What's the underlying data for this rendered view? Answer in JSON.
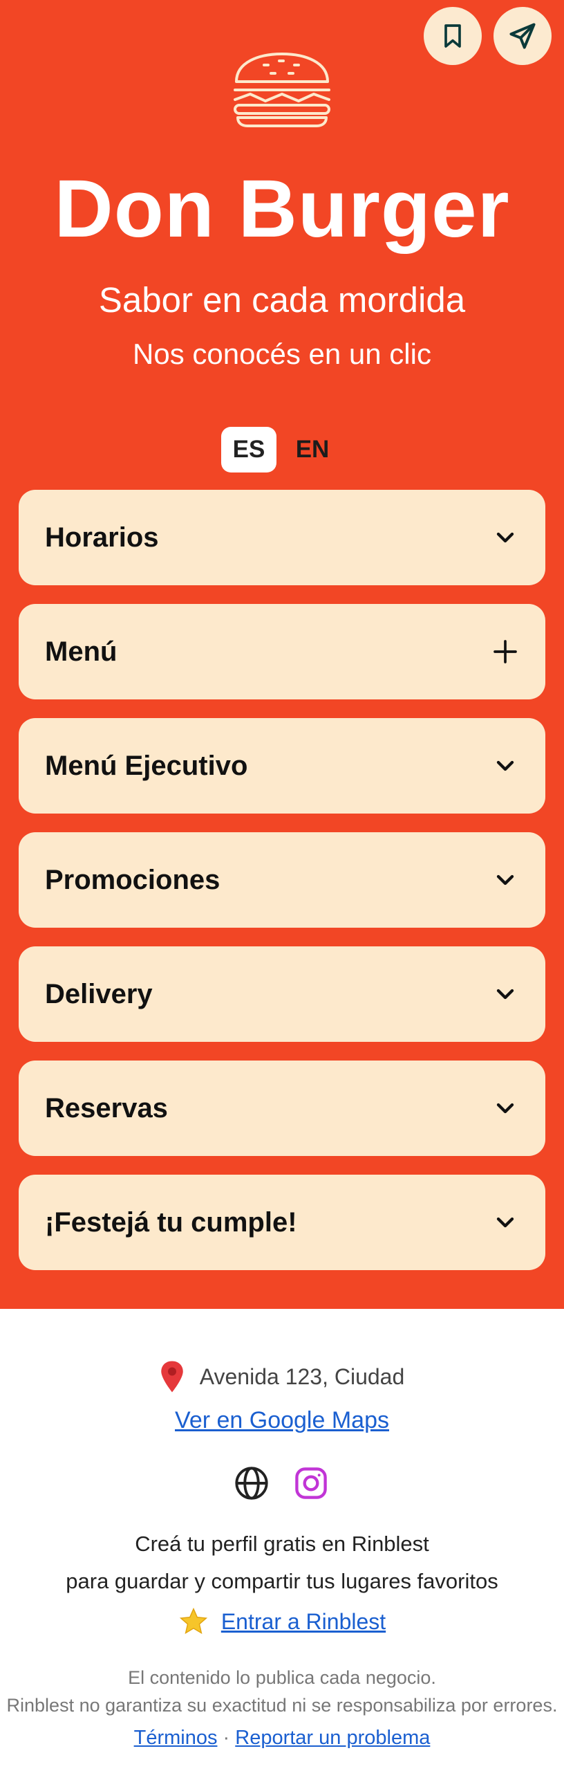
{
  "header": {
    "bookmark_icon": "bookmark-icon",
    "share_icon": "send-icon",
    "logo_icon": "burger-icon",
    "title": "Don Burger",
    "subtitle": "Sabor en cada mordida",
    "tagline": "Nos conocés en un clic"
  },
  "language": {
    "selected": "ES",
    "options": [
      "ES",
      "EN"
    ]
  },
  "sections": [
    {
      "label": "Horarios",
      "icon": "chevron-down-icon"
    },
    {
      "label": "Menú",
      "icon": "plus-icon"
    },
    {
      "label": "Menú Ejecutivo",
      "icon": "chevron-down-icon"
    },
    {
      "label": "Promociones",
      "icon": "chevron-down-icon"
    },
    {
      "label": "Delivery",
      "icon": "chevron-down-icon"
    },
    {
      "label": "Reservas",
      "icon": "chevron-down-icon"
    },
    {
      "label": "¡Festejá tu cumple!",
      "icon": "chevron-down-icon"
    }
  ],
  "footer": {
    "address": "Avenida 123, Ciudad",
    "maps_link": "Ver en Google Maps",
    "social_icons": [
      "globe-icon",
      "instagram-icon"
    ],
    "cta_line1": "Creá tu perfil gratis en Rinblest",
    "cta_line2": "para guardar y compartir tus lugares favoritos",
    "enter_link": "Entrar a Rinblest",
    "disclaimer_line1": "El contenido lo publica cada negocio.",
    "disclaimer_line2": "Rinblest no garantiza su exactitud ni se responsabiliza por errores.",
    "terms_link": "Términos",
    "separator": "·",
    "report_link": "Reportar un problema"
  },
  "colors": {
    "hero_bg": "#f24625",
    "card_bg": "#fde9cc",
    "link": "#1a5fd0",
    "instagram": "#c135d6"
  }
}
